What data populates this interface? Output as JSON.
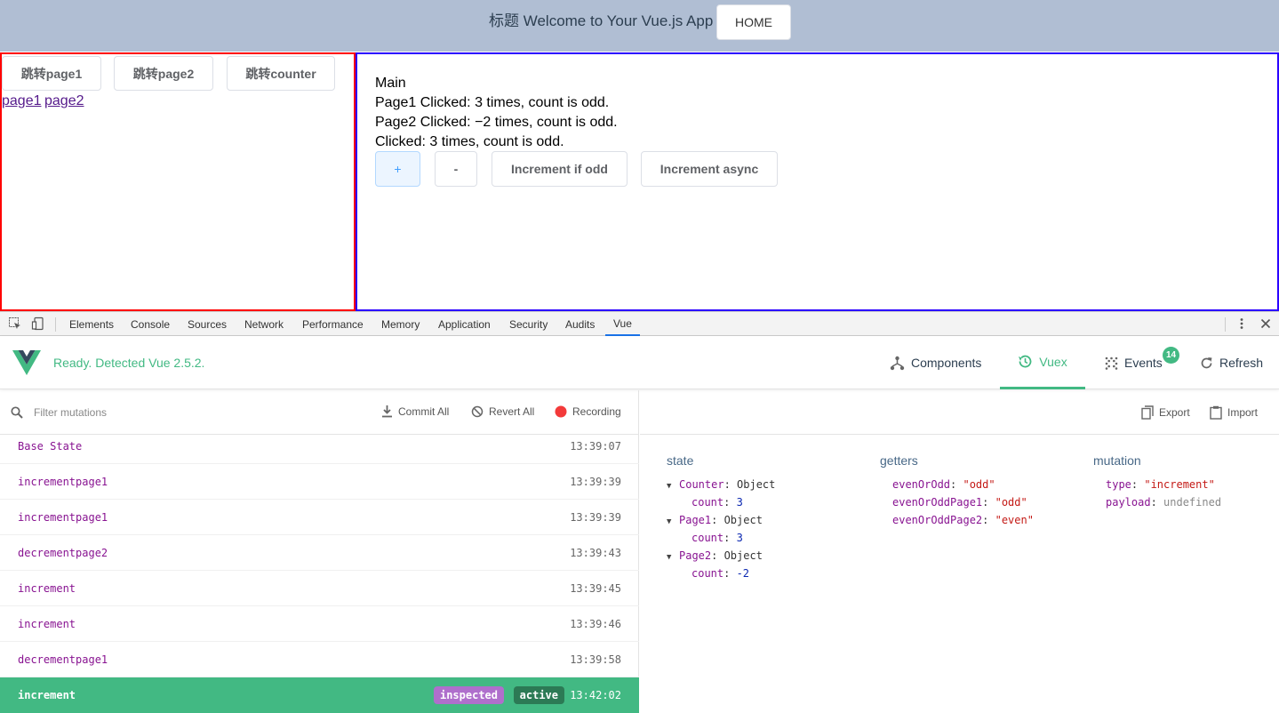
{
  "app": {
    "title": "标题 Welcome to Your Vue.js App",
    "home_label": "HOME",
    "nav_buttons": [
      "跳转page1",
      "跳转page2",
      "跳转counter"
    ],
    "links": [
      "page1",
      "page2"
    ],
    "main": {
      "heading": "Main",
      "lines": [
        "Page1 Clicked: 3 times, count is odd.",
        "Page2 Clicked: −2 times, count is odd.",
        "Clicked: 3 times, count is odd."
      ],
      "buttons": [
        "+",
        "-",
        "Increment if odd",
        "Increment async"
      ]
    }
  },
  "devtools": {
    "tabs": [
      "Elements",
      "Console",
      "Sources",
      "Network",
      "Performance",
      "Memory",
      "Application",
      "Security",
      "Audits",
      "Vue"
    ],
    "active_tab": "Vue"
  },
  "vue_devtools": {
    "status": "Ready. Detected Vue 2.5.2.",
    "tabs": {
      "components": "Components",
      "vuex": "Vuex",
      "events": "Events",
      "refresh": "Refresh"
    },
    "events_badge": "14",
    "active_tab": "Vuex",
    "accent_color": "#42b983"
  },
  "mutations": {
    "filter_placeholder": "Filter mutations",
    "commit_all": "Commit All",
    "revert_all": "Revert All",
    "recording": "Recording",
    "items": [
      {
        "name": "Base State",
        "time": "13:39:07"
      },
      {
        "name": "incrementpage1",
        "time": "13:39:39"
      },
      {
        "name": "incrementpage1",
        "time": "13:39:39"
      },
      {
        "name": "decrementpage2",
        "time": "13:39:43"
      },
      {
        "name": "increment",
        "time": "13:39:45"
      },
      {
        "name": "increment",
        "time": "13:39:46"
      },
      {
        "name": "decrementpage1",
        "time": "13:39:58"
      },
      {
        "name": "increment",
        "time": "13:42:02"
      }
    ],
    "selected": {
      "inspected": "inspected",
      "active": "active"
    }
  },
  "inspector": {
    "export": "Export",
    "import": "Import",
    "state_title": "state",
    "getters_title": "getters",
    "mutation_title": "mutation",
    "state": [
      {
        "key": "Counter",
        "type": "Object",
        "child_key": "count",
        "child_value": "3"
      },
      {
        "key": "Page1",
        "type": "Object",
        "child_key": "count",
        "child_value": "3"
      },
      {
        "key": "Page2",
        "type": "Object",
        "child_key": "count",
        "child_value": "-2"
      }
    ],
    "getters": [
      {
        "key": "evenOrOdd",
        "value": "\"odd\""
      },
      {
        "key": "evenOrOddPage1",
        "value": "\"odd\""
      },
      {
        "key": "evenOrOddPage2",
        "value": "\"even\""
      }
    ],
    "mutation": [
      {
        "key": "type",
        "value": "\"increment\""
      },
      {
        "key": "payload",
        "value": "undefined"
      }
    ]
  }
}
